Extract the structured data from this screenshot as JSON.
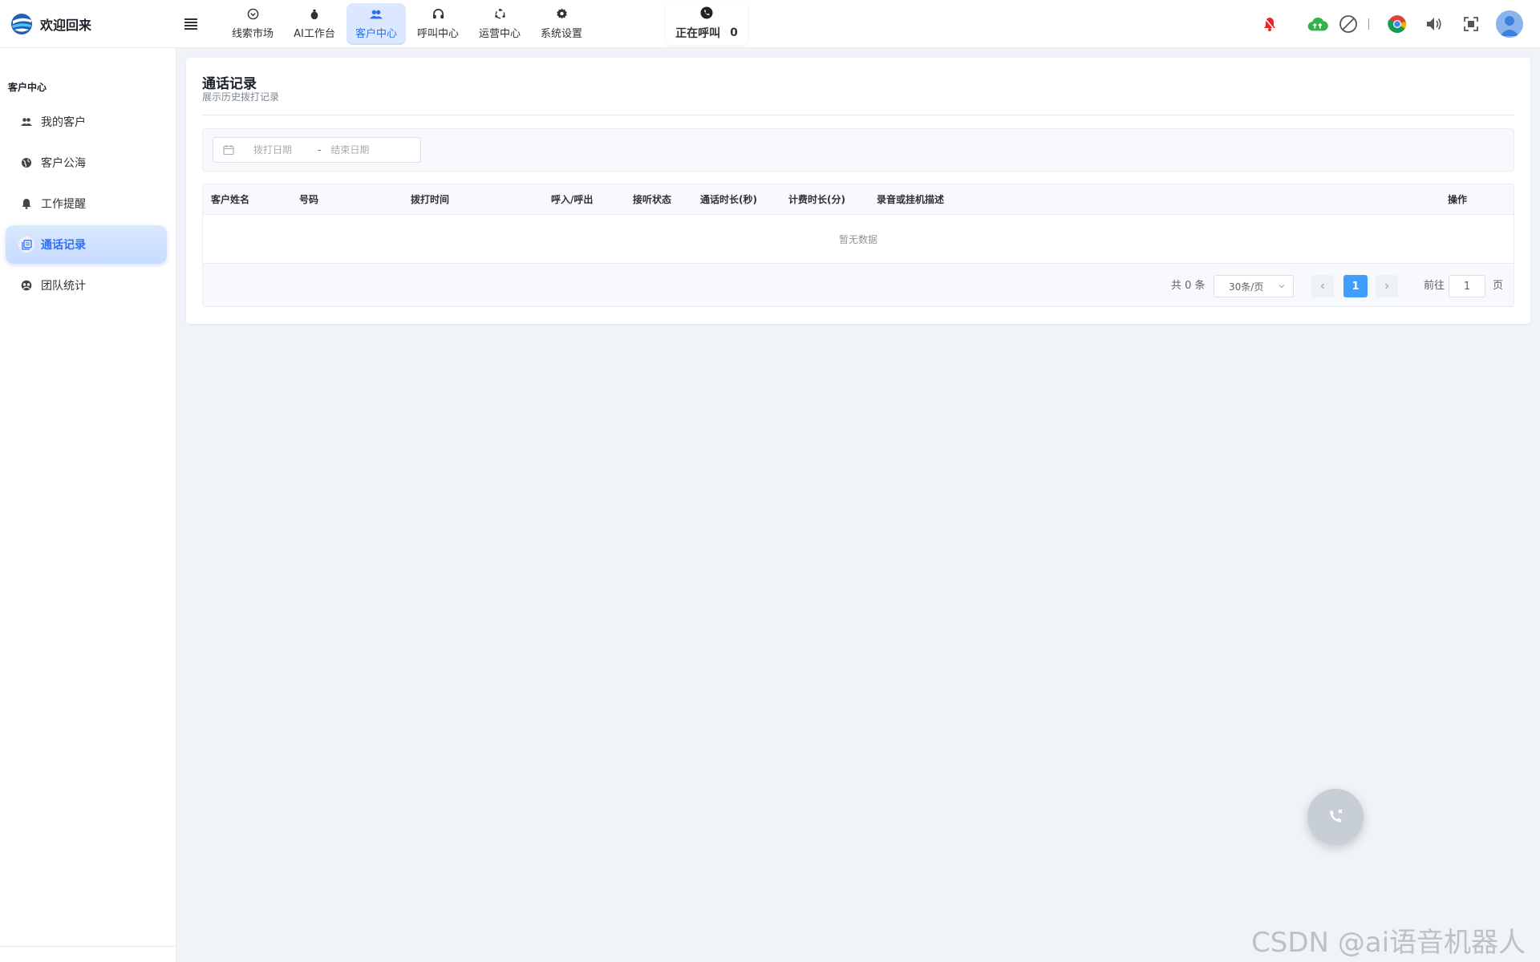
{
  "header": {
    "title": "欢迎回来",
    "nav": [
      {
        "label": "线索市场",
        "icon": "chevron-circle-icon"
      },
      {
        "label": "AI工作台",
        "icon": "bug-icon"
      },
      {
        "label": "客户中心",
        "icon": "users-icon",
        "active": true
      },
      {
        "label": "呼叫中心",
        "icon": "headset-icon"
      },
      {
        "label": "运营中心",
        "icon": "cycle-icon"
      },
      {
        "label": "系统设置",
        "icon": "gear-icon"
      }
    ],
    "calling": {
      "label": "正在呼叫",
      "count": "0"
    }
  },
  "sidebar": {
    "title": "客户中心",
    "items": [
      {
        "label": "我的客户",
        "icon": "people-icon"
      },
      {
        "label": "客户公海",
        "icon": "globe-icon"
      },
      {
        "label": "工作提醒",
        "icon": "bell-icon"
      },
      {
        "label": "通话记录",
        "icon": "records-icon",
        "active": true
      },
      {
        "label": "团队统计",
        "icon": "team-icon"
      }
    ]
  },
  "page": {
    "title": "通话记录",
    "subtitle": "展示历史拨打记录"
  },
  "filters": {
    "start_placeholder": "拨打日期",
    "separator": "-",
    "end_placeholder": "结束日期"
  },
  "table": {
    "columns": [
      "客户姓名",
      "号码",
      "拨打时间",
      "呼入/呼出",
      "接听状态",
      "通话时长(秒)",
      "计费时长(分)",
      "录音或挂机描述",
      "操作"
    ],
    "empty_text": "暂无数据"
  },
  "pagination": {
    "total_text": "共 0 条",
    "page_size": "30条/页",
    "current_page": "1",
    "goto_label": "前往",
    "goto_value": "1",
    "goto_suffix": "页"
  },
  "watermark": "CSDN @ai语音机器人",
  "colors": {
    "accent": "#2e6ff2",
    "page_active": "#409eff",
    "bell_alert": "#e8262a",
    "cloud_green": "#35b34a"
  }
}
